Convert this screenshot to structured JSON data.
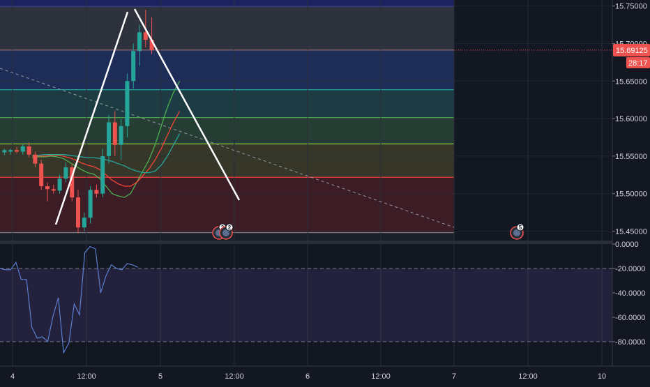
{
  "chart_data": {
    "type": "candlestick",
    "price_axis": {
      "ticks": [
        "15.75000",
        "15.70000",
        "15.65000",
        "15.60000",
        "15.55000",
        "15.50000",
        "15.45000"
      ],
      "tick_values": [
        15.75,
        15.7,
        15.65,
        15.6,
        15.55,
        15.5,
        15.45
      ],
      "range": [
        15.4375,
        15.758
      ]
    },
    "time_axis": {
      "ticks": [
        "4",
        "12:00",
        "5",
        "12:00",
        "6",
        "12:00",
        "7",
        "12:00",
        "10"
      ]
    },
    "current_price": {
      "label": "15.69125",
      "value": 15.69125,
      "countdown": "28:17",
      "color": "#ef5350"
    },
    "fib_zones": [
      {
        "from": 15.7536,
        "to": 15.6913,
        "color": "#787b86"
      },
      {
        "from": 15.6913,
        "to": 15.6385,
        "color": "#2962ff"
      },
      {
        "from": 15.6385,
        "to": 15.6013,
        "color": "#26a69a"
      },
      {
        "from": 15.6013,
        "to": 15.5663,
        "color": "#4caf50"
      },
      {
        "from": 15.5663,
        "to": 15.5218,
        "color": "#9c8f2a"
      },
      {
        "from": 15.5218,
        "to": 15.4481,
        "color": "#b71c1c"
      }
    ],
    "fib_line_colors": [
      "#5b5fc7",
      "#787b86",
      "#26a69a",
      "#4caf50",
      "#8bc34a",
      "#f44336",
      "#787b86"
    ],
    "fib_levels": [
      15.7536,
      15.6913,
      15.6385,
      15.6013,
      15.5663,
      15.5218,
      15.4481
    ],
    "candles": [
      {
        "o": 15.555,
        "h": 15.56,
        "l": 15.551,
        "c": 15.558
      },
      {
        "o": 15.556,
        "h": 15.56,
        "l": 15.552,
        "c": 15.558
      },
      {
        "o": 15.558,
        "h": 15.562,
        "l": 15.554,
        "c": 15.556
      },
      {
        "o": 15.556,
        "h": 15.566,
        "l": 15.552,
        "c": 15.563
      },
      {
        "o": 15.563,
        "h": 15.568,
        "l": 15.548,
        "c": 15.552
      },
      {
        "o": 15.552,
        "h": 15.556,
        "l": 15.535,
        "c": 15.54
      },
      {
        "o": 15.54,
        "h": 15.545,
        "l": 15.505,
        "c": 15.51
      },
      {
        "o": 15.51,
        "h": 15.515,
        "l": 15.49,
        "c": 15.506
      },
      {
        "o": 15.506,
        "h": 15.512,
        "l": 15.5,
        "c": 15.504
      },
      {
        "o": 15.504,
        "h": 15.525,
        "l": 15.5,
        "c": 15.52
      },
      {
        "o": 15.52,
        "h": 15.542,
        "l": 15.515,
        "c": 15.535
      },
      {
        "o": 15.535,
        "h": 15.54,
        "l": 15.49,
        "c": 15.495
      },
      {
        "o": 15.495,
        "h": 15.505,
        "l": 15.447,
        "c": 15.455
      },
      {
        "o": 15.455,
        "h": 15.475,
        "l": 15.45,
        "c": 15.468
      },
      {
        "o": 15.468,
        "h": 15.51,
        "l": 15.46,
        "c": 15.505
      },
      {
        "o": 15.505,
        "h": 15.512,
        "l": 15.495,
        "c": 15.5
      },
      {
        "o": 15.5,
        "h": 15.56,
        "l": 15.495,
        "c": 15.55
      },
      {
        "o": 15.55,
        "h": 15.605,
        "l": 15.54,
        "c": 15.595
      },
      {
        "o": 15.595,
        "h": 15.61,
        "l": 15.55,
        "c": 15.565
      },
      {
        "o": 15.565,
        "h": 15.6,
        "l": 15.545,
        "c": 15.59
      },
      {
        "o": 15.59,
        "h": 15.66,
        "l": 15.575,
        "c": 15.65
      },
      {
        "o": 15.65,
        "h": 15.7,
        "l": 15.64,
        "c": 15.69
      },
      {
        "o": 15.69,
        "h": 15.725,
        "l": 15.67,
        "c": 15.715
      },
      {
        "o": 15.715,
        "h": 15.745,
        "l": 15.695,
        "c": 15.705
      },
      {
        "o": 15.705,
        "h": 15.735,
        "l": 15.686,
        "c": 15.6913
      }
    ],
    "moving_averages": [
      {
        "color": "#4caf50",
        "values": [
          15.548,
          15.549,
          15.549,
          15.55,
          15.549,
          15.547,
          15.542,
          15.537,
          15.532,
          15.528,
          15.526,
          15.52,
          15.51,
          15.5,
          15.497,
          15.495,
          15.5,
          15.515,
          15.53,
          15.545,
          15.565,
          15.59,
          15.615,
          15.635,
          15.65
        ]
      },
      {
        "color": "#f44336",
        "values": [
          15.55,
          15.55,
          15.55,
          15.551,
          15.551,
          15.55,
          15.548,
          15.545,
          15.541,
          15.538,
          15.536,
          15.532,
          15.525,
          15.518,
          15.513,
          15.51,
          15.51,
          15.515,
          15.524,
          15.533,
          15.545,
          15.56,
          15.578,
          15.595,
          15.61
        ]
      },
      {
        "color": "#26a69a",
        "values": [
          15.551,
          15.551,
          15.552,
          15.552,
          15.552,
          15.552,
          15.551,
          15.55,
          15.549,
          15.548,
          15.548,
          15.547,
          15.545,
          15.543,
          15.54,
          15.537,
          15.533,
          15.53,
          15.528,
          15.528,
          15.53,
          15.538,
          15.55,
          15.565,
          15.58
        ]
      }
    ],
    "stochastic": {
      "ticks": [
        "0.0000",
        "-20.0000",
        "-40.0000",
        "-60.0000",
        "-80.0000"
      ],
      "tick_values": [
        0,
        -20,
        -40,
        -60,
        -80
      ],
      "range": [
        -100,
        0
      ],
      "bands": [
        -20,
        -80
      ],
      "line_color": "#5b7fd1",
      "values": [
        -20,
        -21,
        -21,
        -15,
        -29,
        -29,
        -68,
        -77,
        -76,
        -80,
        -59,
        -44,
        -89,
        -81,
        -49,
        -58,
        -7,
        -2,
        -4,
        -40,
        -26,
        -17,
        -20,
        -21,
        -16,
        -17,
        -19
      ]
    },
    "event_badges": [
      {
        "count": "2",
        "color": "#ef5350"
      },
      {
        "count": "2",
        "color": "#ef5350"
      },
      {
        "count": "5",
        "color": "#ef5350"
      }
    ]
  }
}
